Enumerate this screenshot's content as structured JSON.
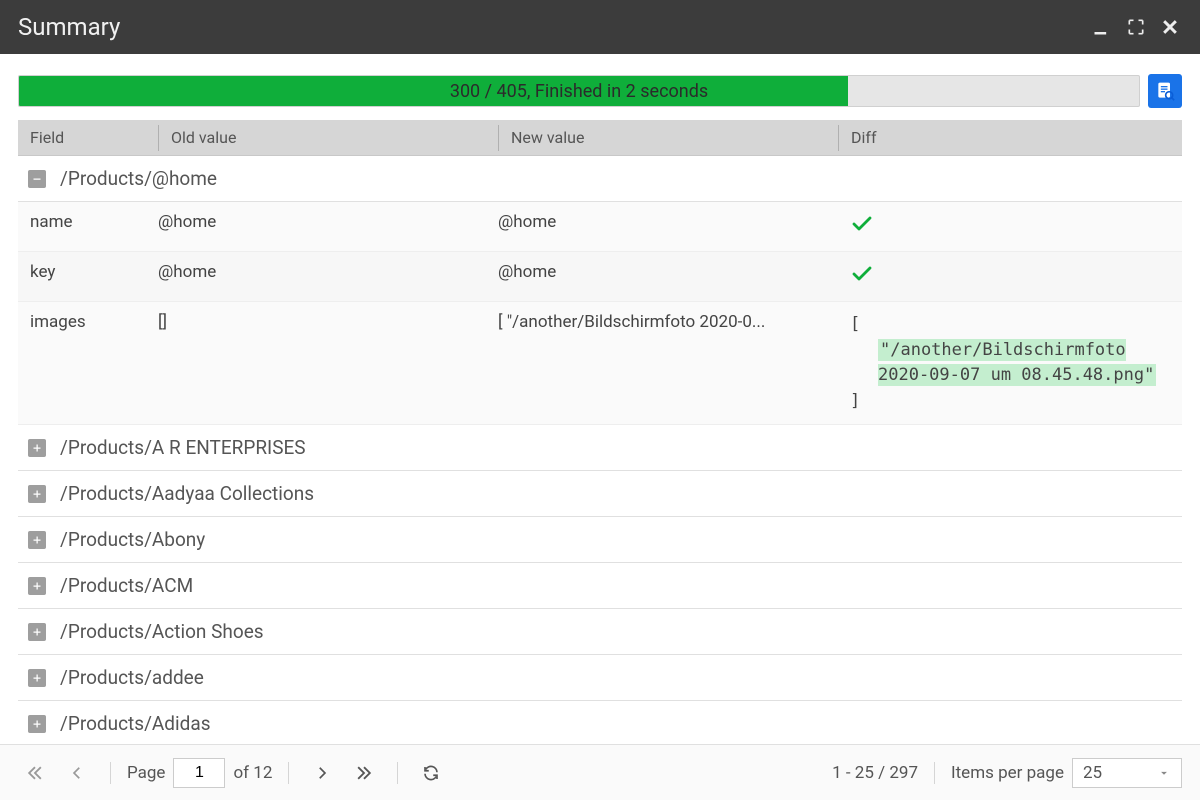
{
  "title": "Summary",
  "progress": {
    "done": 300,
    "total": 405,
    "percent": 74,
    "text": "300 / 405, Finished in 2 seconds"
  },
  "columns": {
    "field": "Field",
    "old": "Old value",
    "new": "New value",
    "diff": "Diff"
  },
  "groups": [
    {
      "expanded": true,
      "path": "/Products/@home",
      "rows": [
        {
          "field": "name",
          "old": "@home",
          "new": "@home",
          "diff_type": "same"
        },
        {
          "field": "key",
          "old": "@home",
          "new": "@home",
          "diff_type": "same"
        },
        {
          "field": "images",
          "old": "[]",
          "new": "[ \"/another/Bildschirmfoto 2020-0...",
          "diff_type": "added",
          "diff_open": "[",
          "diff_added": "\"/another/Bildschirmfoto 2020-09-07 um 08.45.48.png\"",
          "diff_close": "]"
        }
      ]
    },
    {
      "expanded": false,
      "path": "/Products/A R ENTERPRISES"
    },
    {
      "expanded": false,
      "path": "/Products/Aadyaa Collections"
    },
    {
      "expanded": false,
      "path": "/Products/Abony"
    },
    {
      "expanded": false,
      "path": "/Products/ACM"
    },
    {
      "expanded": false,
      "path": "/Products/Action Shoes"
    },
    {
      "expanded": false,
      "path": "/Products/addee"
    },
    {
      "expanded": false,
      "path": "/Products/Adidas"
    }
  ],
  "pager": {
    "page_label": "Page",
    "page": "1",
    "of_label": "of 12",
    "range": "1 - 25 / 297",
    "per_page_label": "Items per page",
    "per_page": "25"
  }
}
